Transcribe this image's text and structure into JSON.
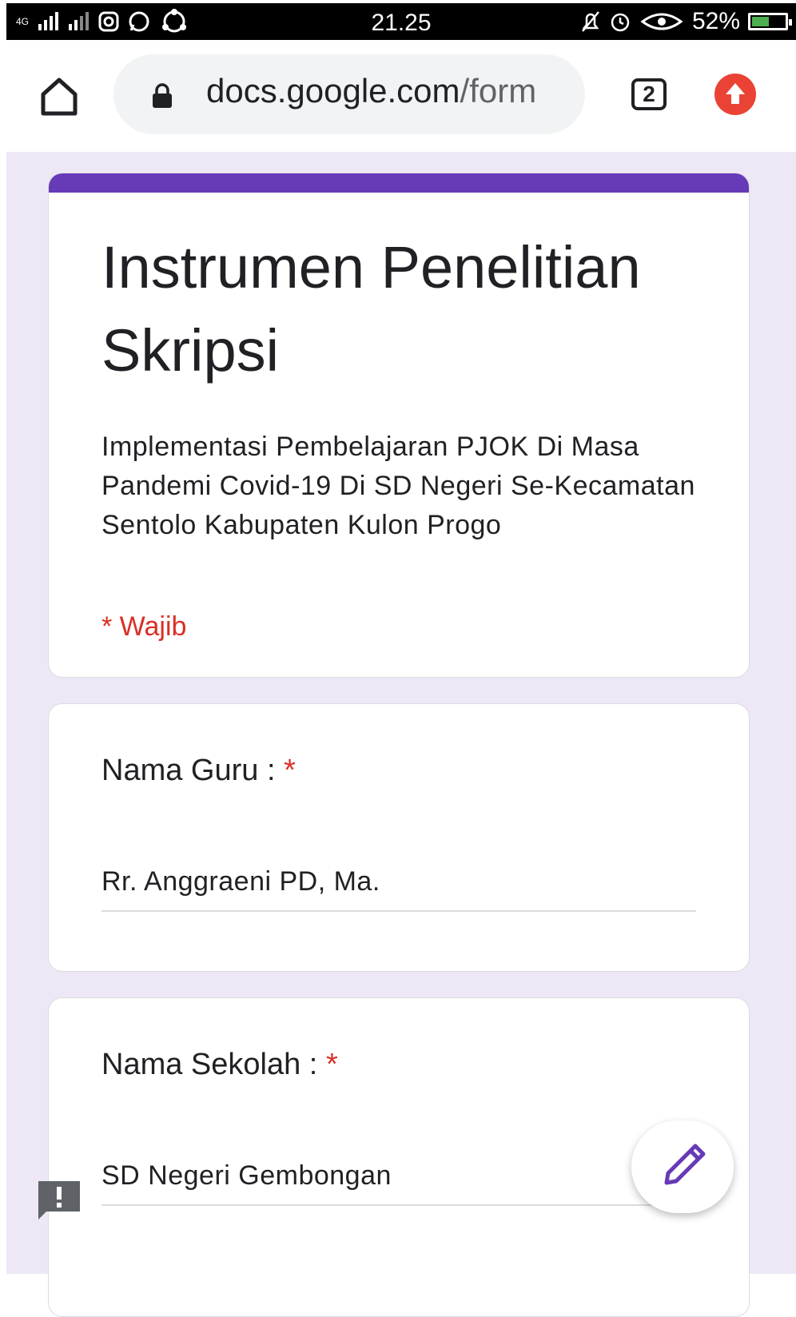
{
  "status_bar": {
    "time": "21.25",
    "battery_text": "52%",
    "network_label": "4G",
    "battery_level": 0.52
  },
  "browser": {
    "url_domain": "docs.google.com",
    "url_path": "/form",
    "tab_count": "2"
  },
  "form": {
    "title": "Instrumen Penelitian Skripsi",
    "description": "Implementasi Pembelajaran PJOK Di Masa Pandemi Covid-19 Di SD Negeri Se-Kecamatan Sentolo Kabupaten Kulon Progo",
    "required_note": "* Wajib",
    "accent_color": "#673ab7",
    "questions": [
      {
        "label": "Nama Guru :",
        "required_mark": "*",
        "answer": "Rr. Anggraeni PD, Ma."
      },
      {
        "label": "Nama Sekolah :",
        "required_mark": "*",
        "answer": "SD Negeri Gembongan"
      }
    ]
  },
  "icons": {
    "home": "home-icon",
    "lock": "lock-icon",
    "update": "arrow-up-icon",
    "edit": "pencil-icon",
    "feedback": "feedback-icon"
  }
}
